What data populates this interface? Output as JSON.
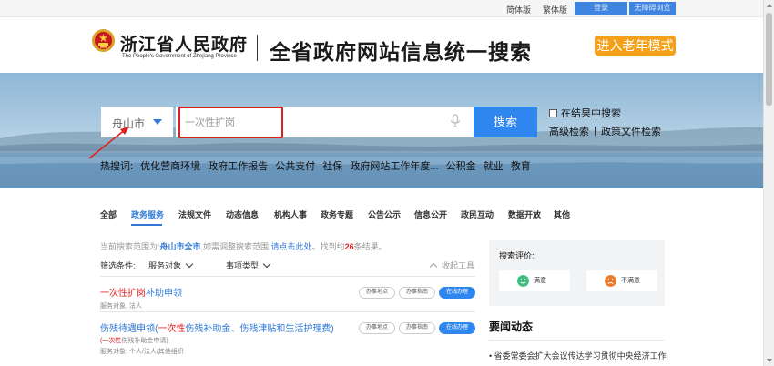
{
  "topbar": {
    "simplified": "简体版",
    "traditional": "繁体版",
    "login": "登录",
    "accessibility": "无障碍浏览"
  },
  "header": {
    "gov_title": "浙江省人民政府",
    "gov_en": "The People's Government of Zhejiang Province",
    "portal_title": "全省政府网站信息统一搜索",
    "elder_mode": "进入老年模式"
  },
  "search": {
    "city": "舟山市",
    "query": "一次性扩岗",
    "button": "搜索",
    "in_results": "在结果中搜索",
    "advanced": "高级检索",
    "policy": "政策文件检索",
    "hot_label": "热搜词:",
    "hot_words": [
      "优化营商环境",
      "政府工作报告",
      "公共支付",
      "社保",
      "政府网站工作年度...",
      "公积金",
      "就业",
      "教育"
    ]
  },
  "tabs": [
    "全部",
    "政务服务",
    "法规文件",
    "动态信息",
    "机构人事",
    "政务专题",
    "公告公示",
    "信息公开",
    "政民互动",
    "数据开放",
    "其他"
  ],
  "scope": {
    "prefix": "当前搜索范围为:",
    "region": "舟山市全市",
    "mid": ",如需调整搜索范围,",
    "link": "请点击此处",
    "found_pre": "。找到约",
    "count": "26",
    "found_post": "条结果。"
  },
  "filters": {
    "label": "筛选条件:",
    "target": "服务对象",
    "type": "事项类型",
    "collapse": "收起工具"
  },
  "results": [
    {
      "title_red": "一次性扩岗",
      "title_rest": "补助申领",
      "sub": "服务对象: 法人",
      "actions": [
        "办事地点",
        "办事指南",
        "在线办理"
      ]
    },
    {
      "title_pre": "伤残待遇申领(",
      "title_red": "一次性",
      "title_rest": "伤残补助金、伤残津贴和生活护理费)",
      "sub_red": "(一次性",
      "sub_rest": "伤残补助金申请)",
      "sub": "服务对象: 个人/法人/其他组织",
      "actions": [
        "办事地点",
        "办事指南",
        "在线办理"
      ]
    }
  ],
  "evaluation": {
    "label": "搜索评价:",
    "satisfied": "满意",
    "unsatisfied": "不满意"
  },
  "news": {
    "title": "要闻动态",
    "item": "• 省委常委会扩大会议传达学习贯彻中央经济工作"
  },
  "colors": {
    "accent": "#2f86ee",
    "highlight": "#e02020",
    "elder": "#f5a01a"
  }
}
